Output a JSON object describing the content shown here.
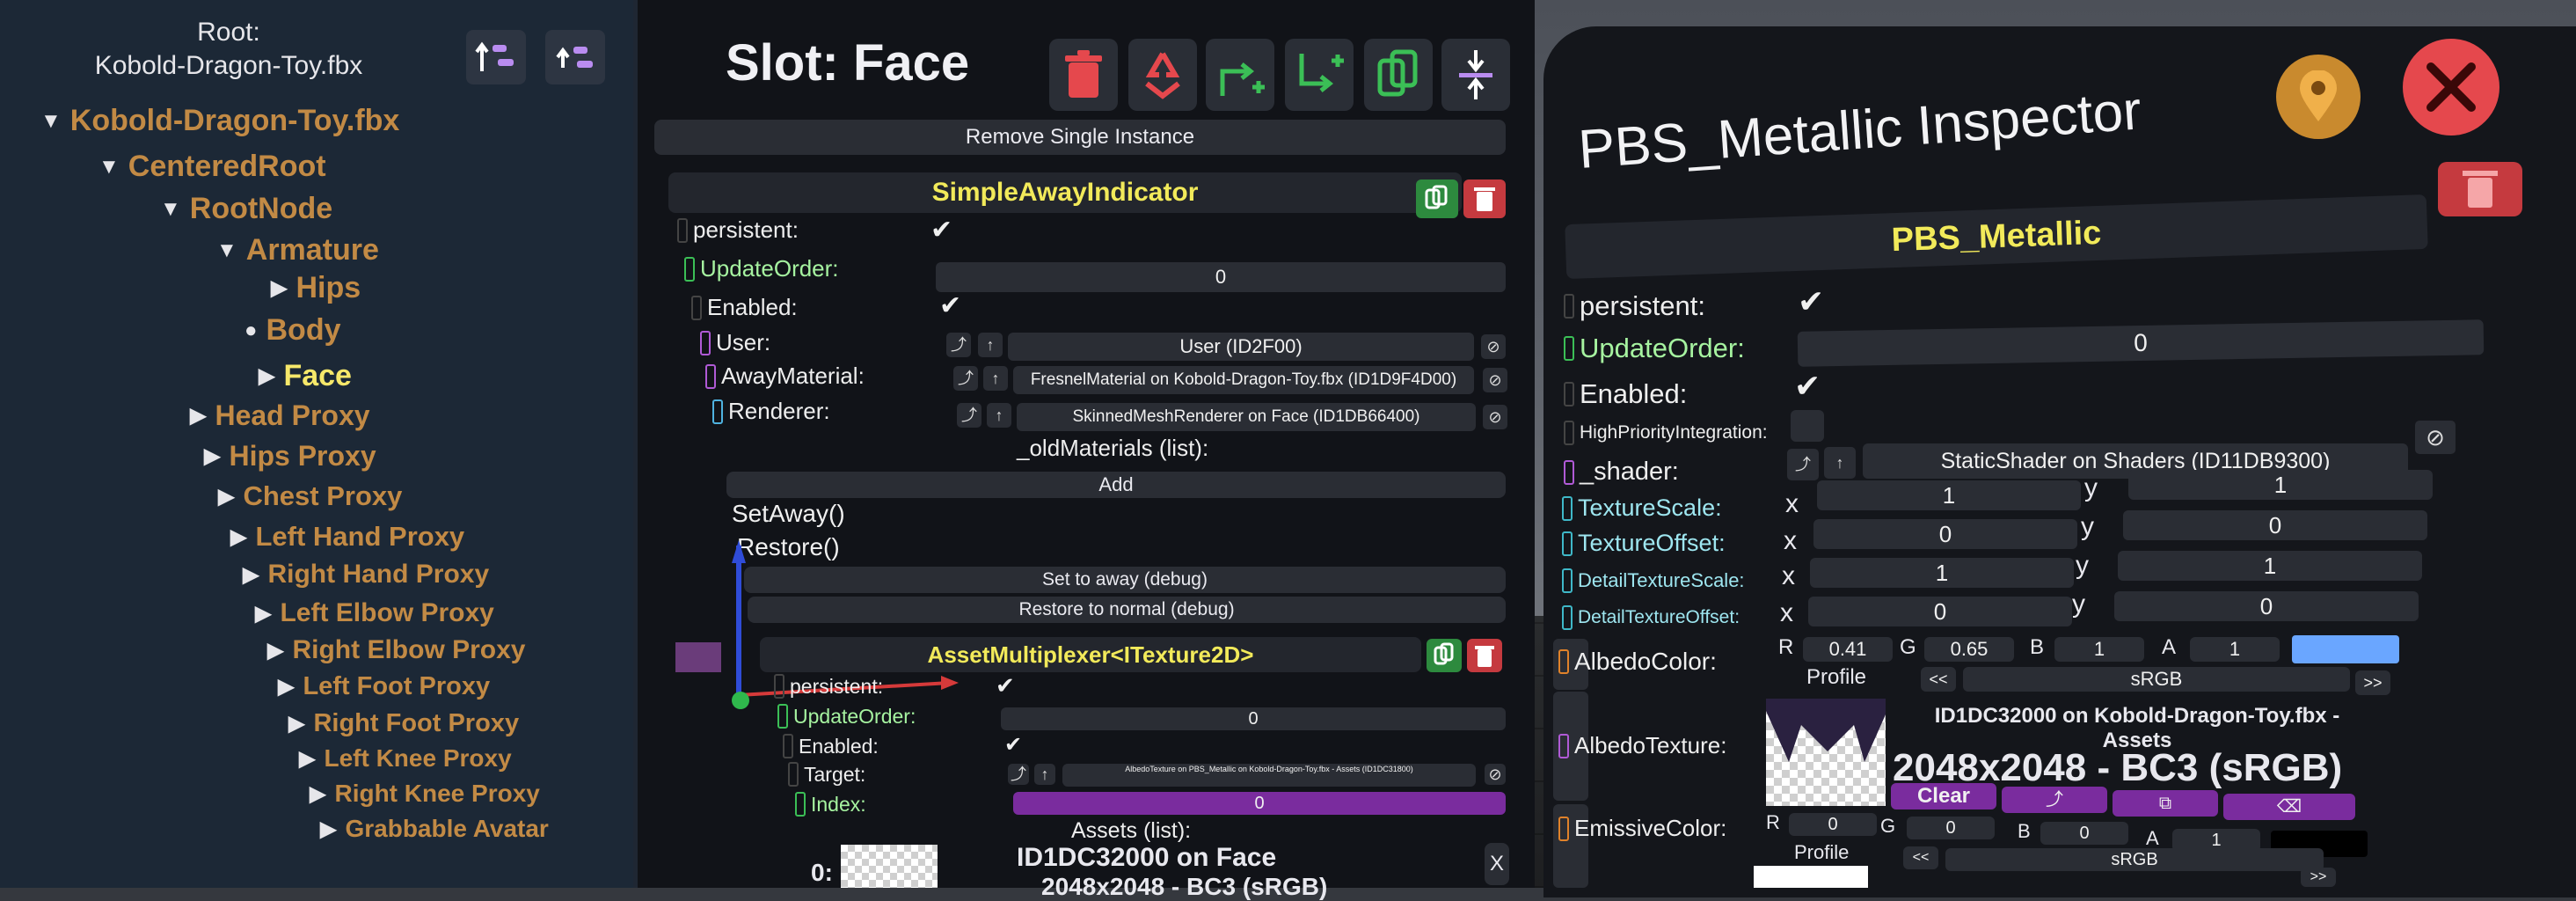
{
  "tree": {
    "root_label": "Root:",
    "root_name": "Kobold-Dragon-Toy.fbx",
    "items": [
      {
        "label": "Kobold-Dragon-Toy.fbx",
        "expander": "▼",
        "depth": 0
      },
      {
        "label": "CenteredRoot",
        "expander": "▼",
        "depth": 1
      },
      {
        "label": "RootNode",
        "expander": "▼",
        "depth": 2
      },
      {
        "label": "Armature",
        "expander": "▼",
        "depth": 3
      },
      {
        "label": "Hips",
        "expander": "▶",
        "depth": 4
      },
      {
        "label": "Body",
        "expander": "●",
        "depth": 3
      },
      {
        "label": "Face",
        "expander": "▶",
        "depth": 3
      },
      {
        "label": "Head Proxy",
        "expander": "▶",
        "depth": 2
      },
      {
        "label": "Hips Proxy",
        "expander": "▶",
        "depth": 2
      },
      {
        "label": "Chest Proxy",
        "expander": "▶",
        "depth": 2
      },
      {
        "label": "Left Hand Proxy",
        "expander": "▶",
        "depth": 2
      },
      {
        "label": "Right Hand Proxy",
        "expander": "▶",
        "depth": 2
      },
      {
        "label": "Left Elbow Proxy",
        "expander": "▶",
        "depth": 2
      },
      {
        "label": "Right Elbow Proxy",
        "expander": "▶",
        "depth": 2
      },
      {
        "label": "Left Foot Proxy",
        "expander": "▶",
        "depth": 2
      },
      {
        "label": "Right Foot Proxy",
        "expander": "▶",
        "depth": 2
      },
      {
        "label": "Left Knee Proxy",
        "expander": "▶",
        "depth": 2
      },
      {
        "label": "Right Knee Proxy",
        "expander": "▶",
        "depth": 2
      },
      {
        "label": "Grabbable Avatar",
        "expander": "▶",
        "depth": 2
      }
    ]
  },
  "slot": {
    "title": "Slot: Face",
    "remove_single_instance": "Remove Single Instance",
    "simple_away": {
      "header": "SimpleAwayIndicator",
      "persistent_label": "persistent:",
      "update_order_label": "UpdateOrder:",
      "update_order_value": "0",
      "enabled_label": "Enabled:",
      "user_label": "User:",
      "user_value": "User  (ID2F00)",
      "away_material_label": "AwayMaterial:",
      "away_material_value": "FresnelMaterial on Kobold-Dragon-Toy.fbx (ID1D9F4D00)",
      "renderer_label": "Renderer:",
      "renderer_value": "SkinnedMeshRenderer on Face (ID1DB66400)",
      "old_materials_label": "_oldMaterials (list):",
      "add_label": "Add",
      "method_set_away": "SetAway()",
      "method_restore": "Restore()",
      "set_away_debug": "Set to away (debug)",
      "restore_debug": "Restore to normal (debug)"
    },
    "asset_multiplexer": {
      "header": "AssetMultiplexer<ITexture2D>",
      "persistent_label": "persistent:",
      "update_order_label": "UpdateOrder:",
      "update_order_value": "0",
      "enabled_label": "Enabled:",
      "target_label": "Target:",
      "target_value": "AlbedoTexture on PBS_Metallic on Kobold-Dragon-Toy.fbx - Assets (ID1DC31800)",
      "index_label": "Index:",
      "index_value": "0",
      "assets_list_label": "Assets (list):",
      "asset_item_name": "ID1DC32000 on Face",
      "asset_item_info": "2048x2048 - BC3 (sRGB)",
      "asset_item_index": "0:",
      "remove_x": "X"
    }
  },
  "inspector": {
    "title": "PBS_Metallic Inspector",
    "component_header": "PBS_Metallic",
    "persistent_label": "persistent:",
    "update_order_label": "UpdateOrder:",
    "update_order_value": "0",
    "enabled_label": "Enabled:",
    "high_priority_label": "HighPriorityIntegration:",
    "shader_label": "_shader:",
    "shader_value": "StaticShader on Shaders (ID11DB9300)",
    "texture_scale_label": "TextureScale:",
    "texture_scale_x": "1",
    "texture_scale_y": "1",
    "texture_offset_label": "TextureOffset:",
    "texture_offset_x": "0",
    "texture_offset_y": "0",
    "detail_scale_label": "DetailTextureScale:",
    "detail_scale_x": "1",
    "detail_scale_y": "1",
    "detail_offset_label": "DetailTextureOffset:",
    "detail_offset_x": "0",
    "detail_offset_y": "0",
    "x_label": "x",
    "y_label": "y",
    "albedo_color_label": "AlbedoColor:",
    "r_label": "R",
    "g_label": "G",
    "b_label": "B",
    "a_label": "A",
    "albedo_r": "0.41",
    "albedo_g": "0.65",
    "albedo_b": "1",
    "albedo_a": "1",
    "albedo_swatch": "#6aa6ff",
    "profile_label": "Profile",
    "profile_prev": "<<",
    "profile_next": ">>",
    "profile_value": "sRGB",
    "albedo_texture_label": "AlbedoTexture:",
    "albedo_texture_name": "ID1DC32000 on Kobold-Dragon-Toy.fbx - Assets",
    "albedo_texture_info": "2048x2048 - BC3 (sRGB)",
    "clear_label": "Clear",
    "emissive_color_label": "EmissiveColor:",
    "emissive_r": "0",
    "emissive_g": "0",
    "emissive_b": "0",
    "emissive_a": "1",
    "emissive_profile_value": "sRGB"
  },
  "colors": {
    "tree_text": "#c28a45",
    "selected_text": "#f6e86a",
    "component_header": "#f2ea5a",
    "delete_red": "#e5484d",
    "duplicate_green": "#3bbf56",
    "index_purple": "#7a2c9e",
    "clear_purple": "#7a2c9e",
    "locate_orange": "#c98a2e"
  }
}
